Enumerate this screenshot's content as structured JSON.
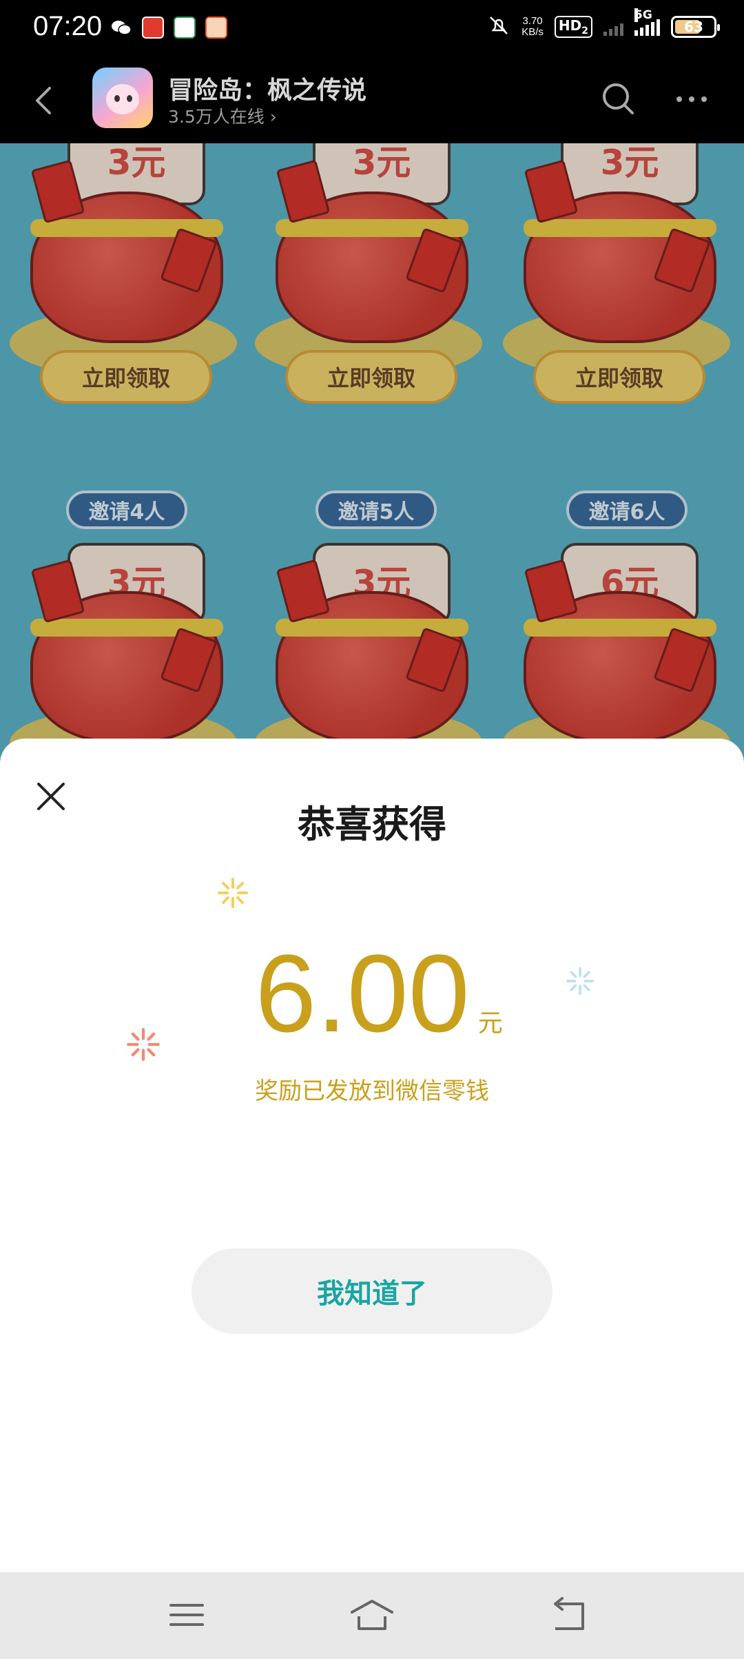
{
  "status_bar": {
    "time": "07:20",
    "net_speed_value": "3.70",
    "net_speed_unit": "KB/s",
    "hd_label": "HD",
    "hd_sub": "2",
    "network_label": "5G",
    "battery_percent": "63",
    "notification_apps": [
      "wechat-icon",
      "shop-app-icon",
      "bank-app-icon",
      "game-app-icon"
    ]
  },
  "header": {
    "title": "冒险岛：枫之传说",
    "subtitle": "3.5万人在线 ›"
  },
  "game_bg": {
    "top_row": [
      {
        "amount": "3元",
        "button": "立即领取"
      },
      {
        "amount": "3元",
        "button": "立即领取"
      },
      {
        "amount": "3元",
        "button": "立即领取"
      }
    ],
    "bottom_row": [
      {
        "invite": "邀请4人",
        "amount": "3元"
      },
      {
        "invite": "邀请5人",
        "amount": "3元"
      },
      {
        "invite": "邀请6人",
        "amount": "6元"
      }
    ]
  },
  "modal": {
    "title": "恭喜获得",
    "amount": "6.00",
    "unit": "元",
    "note": "奖励已发放到微信零钱",
    "button": "我知道了"
  },
  "colors": {
    "accent_gold": "#c9a01c",
    "button_text": "#1aa5a3"
  }
}
